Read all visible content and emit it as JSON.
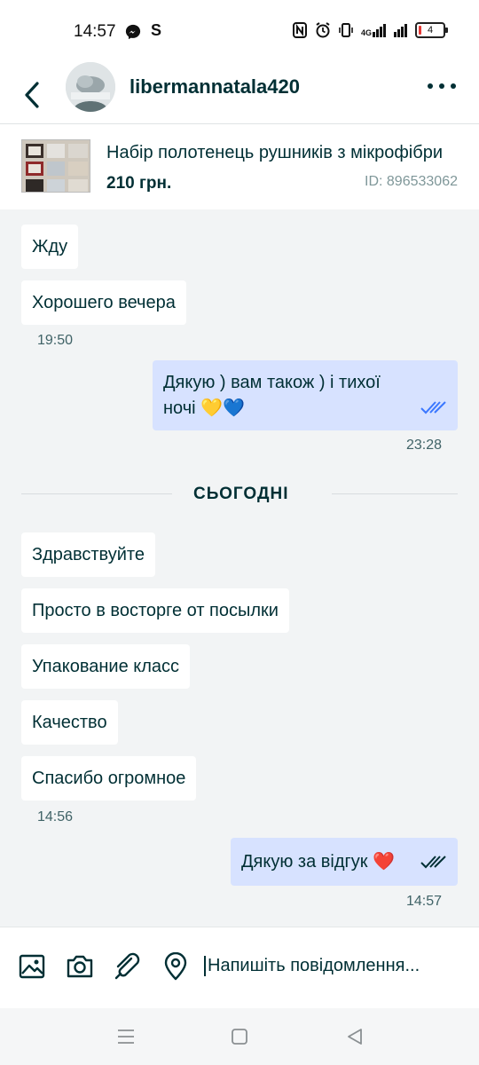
{
  "status_bar": {
    "time": "14:57",
    "app_icons": [
      "messenger-icon",
      "s-icon"
    ],
    "s_label": "S",
    "network": "4G",
    "battery": "4"
  },
  "header": {
    "username": "libermannatala420",
    "back_icon": "chevron-left-icon",
    "more_icon": "more-dots-icon"
  },
  "product": {
    "title": "Набір полотенець рушників з мікрофібри",
    "price": "210 грн.",
    "id": "ID: 896533062"
  },
  "messages": [
    {
      "text": "Жду",
      "sender": "other"
    },
    {
      "text": "Хорошего вечера",
      "sender": "other"
    },
    {
      "time": "19:50"
    },
    {
      "text_line1": "Дякую ) вам також ) і тихої",
      "text_line2": "ночі 💛💙",
      "sender": "me",
      "read": true
    },
    {
      "time": "23:28"
    },
    {
      "divider": "СЬОГОДНІ"
    },
    {
      "text": "Здравствуйте",
      "sender": "other"
    },
    {
      "text": "Просто в восторге от посылки",
      "sender": "other"
    },
    {
      "text": "Упакование класс",
      "sender": "other"
    },
    {
      "text": "Качество",
      "sender": "other"
    },
    {
      "text": "Спасибо огромное",
      "sender": "other"
    },
    {
      "time": "14:56"
    },
    {
      "text": "Дякую за відгук ❤️",
      "sender": "me",
      "read": true
    },
    {
      "time": "14:57"
    }
  ],
  "composer": {
    "placeholder": "Напишіть повідомлення...",
    "icons": [
      "image-icon",
      "camera-icon",
      "attachment-icon",
      "location-icon"
    ]
  },
  "colors": {
    "primary_text": "#002f34",
    "my_bubble": "#d7e2ff",
    "other_bubble": "#ffffff",
    "chat_background": "#f2f4f5",
    "read_tick": "#3a77ff"
  }
}
